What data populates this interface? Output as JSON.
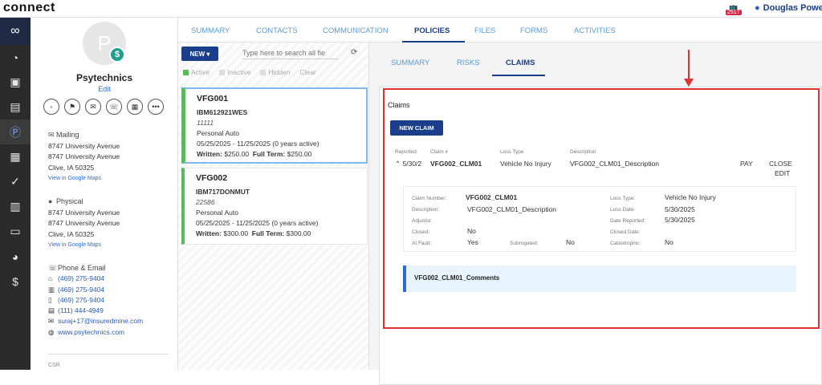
{
  "app": {
    "name": "connect",
    "badge_count": "2517",
    "user_name": "Douglas Powe"
  },
  "nav_icons": [
    "dashboard-icon",
    "contact-card-icon",
    "id-card-icon",
    "policy-icon",
    "document-icon",
    "check-icon",
    "calendar-icon",
    "archive-icon",
    "chart-icon",
    "dollar-icon"
  ],
  "profile": {
    "avatar_initial": "P",
    "name": "Psytechnics",
    "edit_label": "Edit",
    "mailing": {
      "title": "Mailing",
      "line1": "8747 University Avenue",
      "line2": "8747 University Avenue",
      "line3": "Clive, IA 50325",
      "map_link": "View in Google Maps"
    },
    "physical": {
      "title": "Physical",
      "line1": "8747 University Avenue",
      "line2": "8747 University Avenue",
      "line3": "Clive, IA 50325",
      "map_link": "View in Google Maps"
    },
    "contact_title": "Phone & Email",
    "phones": [
      "(469) 275-9404",
      "(469) 275-9404",
      "(469) 275-9404",
      "(111) 444-4949"
    ],
    "email": "suraj+17@insuredmine.com",
    "website": "www.psytechnics.com",
    "csr_label": "CSR"
  },
  "tabs": [
    "SUMMARY",
    "CONTACTS",
    "COMMUNICATION",
    "POLICIES",
    "FILES",
    "FORMS",
    "ACTIVITIES"
  ],
  "policies": {
    "new_label": "NEW",
    "search_placeholder": "Type here to search all fie",
    "filters": [
      "Active",
      "Inactive",
      "Hidden",
      "Clear"
    ],
    "items": [
      {
        "code": "VFG001",
        "number": "IBM612921WES",
        "id": "11111",
        "type": "Personal Auto",
        "period": "05/25/2025 - 11/25/2025 (0 years active)",
        "written_label": "Written:",
        "written": "$250.00",
        "full_label": "Full Term:",
        "full": "$250.00"
      },
      {
        "code": "VFG002",
        "number": "IBM717DONMUT",
        "id": "22586",
        "type": "Personal Auto",
        "period": "05/25/2025 - 11/25/2025 (0 years active)",
        "written_label": "Written:",
        "written": "$300.00",
        "full_label": "Full Term:",
        "full": "$300.00"
      }
    ]
  },
  "subtabs": [
    "SUMMARY",
    "RISKS",
    "CLAIMS"
  ],
  "claims": {
    "title": "Claims",
    "new_claim_label": "NEW CLAIM",
    "headers": {
      "reported": "Reported",
      "claim_no": "Claim #",
      "loss_type": "Loss Type",
      "description": "Description"
    },
    "row": {
      "reported": "5/30/2",
      "claim_no": "VFG002_CLM01",
      "loss_type": "Vehicle No Injury",
      "description": "VFG002_CLM01_Description",
      "pay": "PAY",
      "close": "CLOSE",
      "edit": "EDIT"
    },
    "detail": {
      "claim_number_label": "Claim Number:",
      "claim_number": "VFG002_CLM01",
      "description_label": "Description:",
      "description": "VFG002_CLM01_Description",
      "adjustor_label": "Adjustor:",
      "closed_label": "Closed:",
      "closed": "No",
      "at_fault_label": "At Fault:",
      "at_fault": "Yes",
      "subrogated_label": "Subrogated:",
      "subrogated": "No",
      "loss_type_label": "Loss Type:",
      "loss_type": "Vehicle No Injury",
      "loss_date_label": "Loss Date:",
      "loss_date": "5/30/2025",
      "date_reported_label": "Date Reported:",
      "date_reported": "5/30/2025",
      "closed_date_label": "Closed Date:",
      "catastrophic_label": "Catastrophic:",
      "catastrophic": "No"
    },
    "comments_label": "VFG002_CLM01_Comments"
  }
}
